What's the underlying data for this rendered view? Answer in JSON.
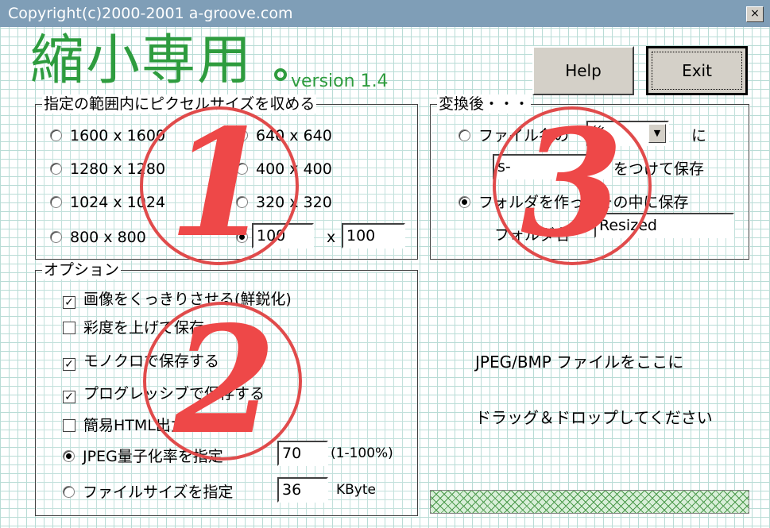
{
  "titlebar": {
    "text": "Copyright(c)2000-2001 a-groove.com",
    "close_label": "×"
  },
  "app": {
    "title": "縮小専用",
    "version": "version 1.4"
  },
  "buttons": {
    "help": "Help",
    "exit": "Exit"
  },
  "size_group": {
    "legend": "指定の範囲内にピクセルサイズを収める",
    "options": [
      "1600 x 1600",
      "640 x 640",
      "1280 x 1280",
      "400 x 400",
      "1024 x 1024",
      "320 x 320",
      "800 x 800"
    ],
    "custom_width": "100",
    "custom_x": "x",
    "custom_height": "100"
  },
  "convert_group": {
    "legend": "変換後・・・",
    "filename_label": "ファイル名の",
    "position_value": "後",
    "ni": "に",
    "prefix_value": "s-",
    "append_label": "をつけて保存",
    "folder_option": "フォルダを作ってその中に保存",
    "folder_label": "フォルダ名",
    "folder_value": "Resized"
  },
  "options_group": {
    "legend": "オプション",
    "sharpen": "画像をくっきりさせる(鮮鋭化)",
    "saturation": "彩度を上げて保存",
    "mono": "モノクロで保存する",
    "progressive": "プログレッシブで保存する",
    "html": "簡易HTML出力",
    "jpeg_quality_label": "JPEG量子化率を指定",
    "jpeg_quality_value": "70",
    "jpeg_range": "(1-100%)",
    "filesize_label": "ファイルサイズを指定",
    "filesize_value": "36",
    "filesize_unit": "KByte"
  },
  "drop": {
    "line1": "JPEG/BMP ファイルをここに",
    "line2": "ドラッグ＆ドロップしてください"
  },
  "annotations": [
    "1",
    "2",
    "3"
  ],
  "colors": {
    "title_green": "#2e9c3e",
    "annotation_red": "#e04b4b",
    "titlebar": "#7f9eb7"
  }
}
